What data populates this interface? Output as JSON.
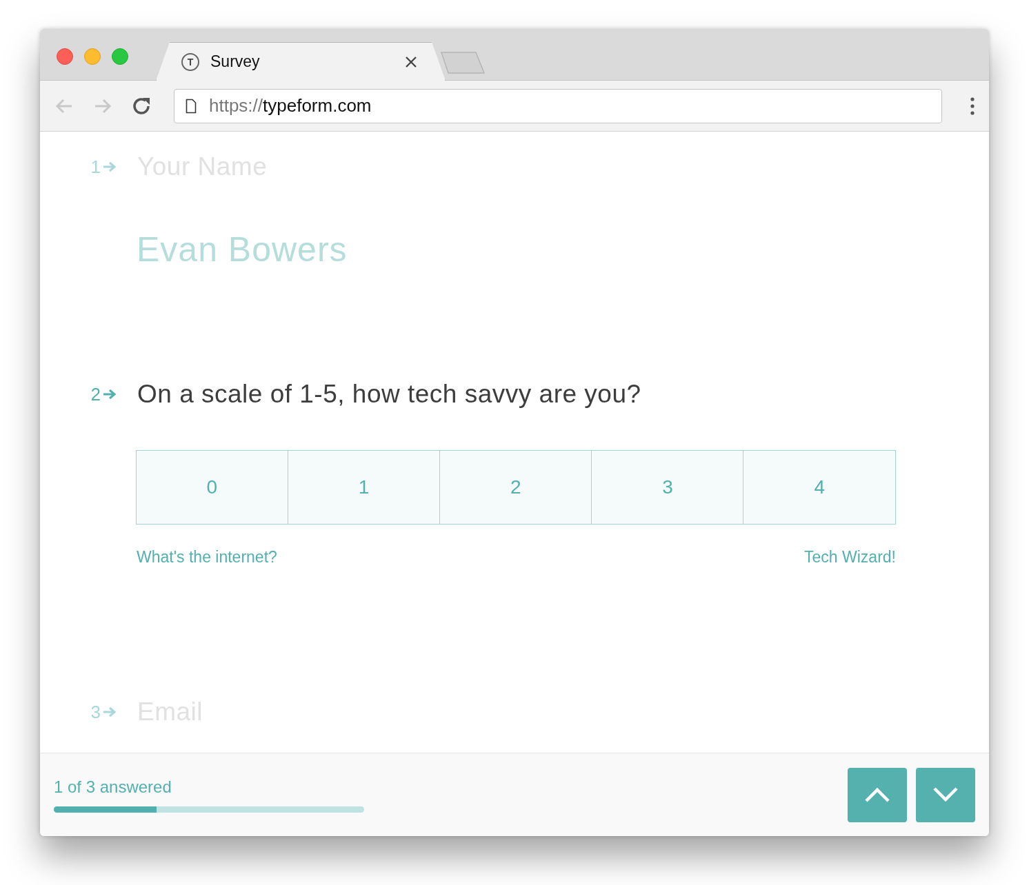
{
  "tab": {
    "favicon": "T",
    "title": "Survey"
  },
  "address": {
    "scheme": "https://",
    "host": "typeform.com"
  },
  "questions": [
    {
      "number": "1",
      "title": "Your Name",
      "active": false,
      "kind": "text",
      "answer": "Evan Bowers"
    },
    {
      "number": "2",
      "title": "On a scale of 1-5, how tech savvy are you?",
      "active": true,
      "kind": "scale",
      "options": [
        {
          "label": "0",
          "selected": false
        },
        {
          "label": "1",
          "selected": false
        },
        {
          "label": "2",
          "selected": false
        },
        {
          "label": "3",
          "selected": false
        },
        {
          "label": "4",
          "selected": false
        }
      ],
      "min_label": "What's the internet?",
      "max_label": "Tech Wizard!"
    },
    {
      "number": "3",
      "title": "Email",
      "active": false,
      "kind": "text"
    }
  ],
  "footer": {
    "progress_text": "1 of 3 answered",
    "level": 0.33
  }
}
